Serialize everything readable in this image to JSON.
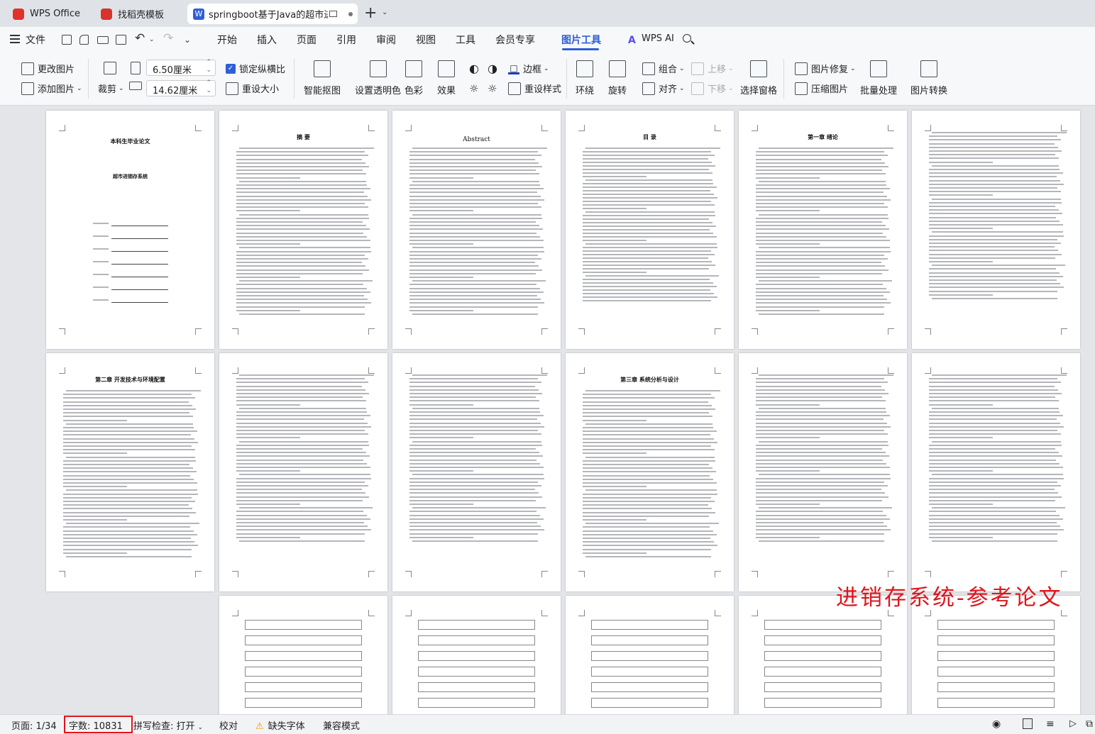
{
  "tabs": [
    {
      "label": "WPS Office"
    },
    {
      "label": "找稻壳模板"
    },
    {
      "label": "springboot基于Java的超市进"
    }
  ],
  "menu": {
    "file": "文件",
    "items": [
      "开始",
      "插入",
      "页面",
      "引用",
      "审阅",
      "视图",
      "工具",
      "会员专享",
      "图片工具"
    ],
    "active": "图片工具",
    "ai": "WPS AI"
  },
  "ribbon": {
    "change_image": "更改图片",
    "add_image": "添加图片",
    "crop": "裁剪",
    "height_value": "6.50厘米",
    "width_value": "14.62厘米",
    "lock_ratio": "锁定纵横比",
    "resize": "重设大小",
    "smart_cutout": "智能抠图",
    "set_transparent": "设置透明色",
    "color": "色彩",
    "effects": "效果",
    "border": "边框",
    "reset_style": "重设样式",
    "wrap": "环绕",
    "rotate": "旋转",
    "group": "组合",
    "align": "对齐",
    "bring_forward": "上移",
    "send_backward": "下移",
    "selection_pane": "选择窗格",
    "repair": "图片修复",
    "compress": "压缩图片",
    "batch": "批量处理",
    "convert": "图片转换"
  },
  "pages": {
    "cover_title": "本科生毕业论文",
    "cover_subtitle": "超市进销存系统",
    "abstract_cn": "摘 要",
    "abstract_en": "Abstract",
    "toc": "目 录",
    "ch1": "第一章 绪论",
    "ch2": "第二章 开发技术与环境配置",
    "ch3": "第三章 系统分析与设计"
  },
  "watermark": "进销存系统-参考论文",
  "status": {
    "page": "页面: 1/34",
    "word_count": "字数: 10831",
    "spell_check": "拼写检查: 打开",
    "proofread": "校对",
    "missing_font": "缺失字体",
    "compat": "兼容模式"
  },
  "colors": {
    "accent": "#2f5fd6",
    "highlight_box": "#e0141b",
    "watermark": "#e0141b"
  }
}
